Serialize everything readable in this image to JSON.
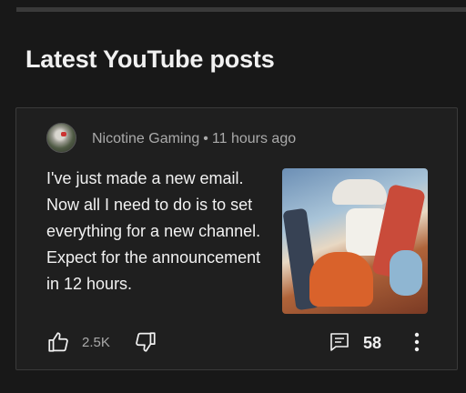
{
  "section": {
    "title": "Latest YouTube posts"
  },
  "post": {
    "channel_name": "Nicotine Gaming",
    "separator": "•",
    "time_ago": "11 hours ago",
    "text": "I've just made a new email. Now all I need to do is to set everything for a new channel. Expect for the announcement in 12 hours.",
    "like_count": "2.5K",
    "comment_count": "58"
  },
  "icons": {
    "like": "thumbs-up-icon",
    "dislike": "thumbs-down-icon",
    "comment": "comment-icon",
    "more": "more-vert-icon"
  },
  "colors": {
    "background": "#181818",
    "card": "#1f1f1f",
    "card_border": "#3a3a3a",
    "primary_text": "#f1f1f1",
    "secondary_text": "#aaaaaa"
  }
}
